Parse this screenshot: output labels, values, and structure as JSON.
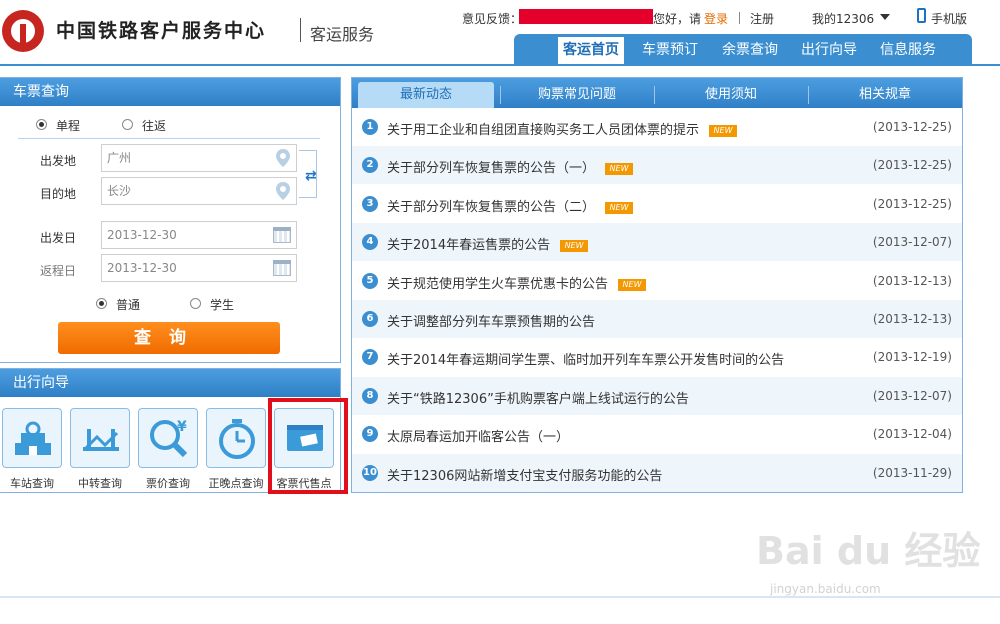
{
  "header": {
    "site_title": "中国铁路客户服务中心",
    "site_sub": "客运服务",
    "feedback_label": "意见反馈：",
    "greeting": "您好，请",
    "login": "登录",
    "register": "注册",
    "my12306": "我的12306",
    "mobile": "手机版"
  },
  "nav": {
    "items": [
      {
        "label": "客运首页",
        "active": true
      },
      {
        "label": "车票预订"
      },
      {
        "label": "余票查询"
      },
      {
        "label": "出行向导"
      },
      {
        "label": "信息服务"
      }
    ]
  },
  "ticket": {
    "title": "车票查询",
    "trip_types": [
      "单程",
      "往返"
    ],
    "from_label": "出发地",
    "from_value": "广州",
    "to_label": "目的地",
    "to_value": "长沙",
    "depart_label": "出发日",
    "depart_value": "2013-12-30",
    "return_label": "返程日",
    "return_value": "2013-12-30",
    "passenger_types": [
      "普通",
      "学生"
    ],
    "query_button": "查询"
  },
  "guide": {
    "title": "出行向导",
    "tiles": [
      "车站查询",
      "中转查询",
      "票价查询",
      "正晚点查询",
      "客票代售点"
    ]
  },
  "news": {
    "tabs": [
      "最新动态",
      "购票常见问题",
      "使用须知",
      "相关规章"
    ],
    "new_badge": "NEW",
    "items": [
      {
        "num": "1",
        "title": "关于用工企业和自组团直接购买务工人员团体票的提示",
        "date": "(2013-12-25)",
        "is_new": true
      },
      {
        "num": "2",
        "title": "关于部分列车恢复售票的公告（一）",
        "date": "(2013-12-25)",
        "is_new": true
      },
      {
        "num": "3",
        "title": "关于部分列车恢复售票的公告（二）",
        "date": "(2013-12-25)",
        "is_new": true
      },
      {
        "num": "4",
        "title": "关于2014年春运售票的公告",
        "date": "(2013-12-07)",
        "is_new": true
      },
      {
        "num": "5",
        "title": "关于规范使用学生火车票优惠卡的公告",
        "date": "(2013-12-13)",
        "is_new": true
      },
      {
        "num": "6",
        "title": "关于调整部分列车车票预售期的公告",
        "date": "(2013-12-13)",
        "is_new": false
      },
      {
        "num": "7",
        "title": "关于2014年春运期间学生票、临时加开列车车票公开发售时间的公告",
        "date": "(2013-12-19)",
        "is_new": false
      },
      {
        "num": "8",
        "title": "关于“铁路12306”手机购票客户端上线试运行的公告",
        "date": "(2013-12-07)",
        "is_new": false
      },
      {
        "num": "9",
        "title": "太原局春运加开临客公告（一）",
        "date": "(2013-12-04)",
        "is_new": false
      },
      {
        "num": "10",
        "title": "关于12306网站新增支付宝支付服务功能的公告",
        "date": "(2013-11-29)",
        "is_new": false
      }
    ]
  },
  "watermark": {
    "main": "Bai du 经验",
    "sub": "jingyan.baidu.com"
  },
  "colors": {
    "brand_blue": "#3b8fd1",
    "accent_orange": "#f06b00",
    "highlight_red": "#e00f1b",
    "logo_red": "#c6261f"
  }
}
